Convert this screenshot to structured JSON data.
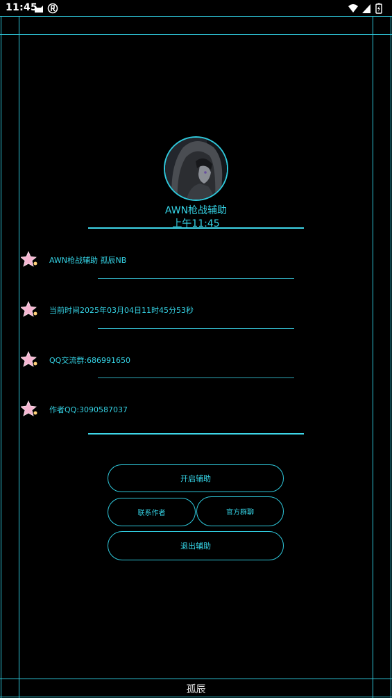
{
  "status_bar": {
    "time": "11:45",
    "icons": [
      "cat-icon",
      "app-icon",
      "wifi-icon",
      "signal-icon",
      "battery-icon"
    ]
  },
  "header": {
    "title": "AWN枪战辅助",
    "time": "上午11:45"
  },
  "info_rows": [
    {
      "icon": "star-icon",
      "text": "AWN枪战辅助 孤辰NB"
    },
    {
      "icon": "star-icon",
      "text": "当前时间2025年03月04日11时45分53秒"
    },
    {
      "icon": "star-icon",
      "text": "QQ交流群:686991650"
    },
    {
      "icon": "star-icon",
      "text": "作者QQ:3090587037"
    }
  ],
  "buttons": {
    "start": "开启辅助",
    "contact_author": "联系作者",
    "official_group": "官方群聊",
    "exit": "退出辅助"
  },
  "footer": {
    "label": "孤辰"
  },
  "colors": {
    "accent": "#35d4e6",
    "frame": "#2fc9dc",
    "background": "#000000"
  }
}
